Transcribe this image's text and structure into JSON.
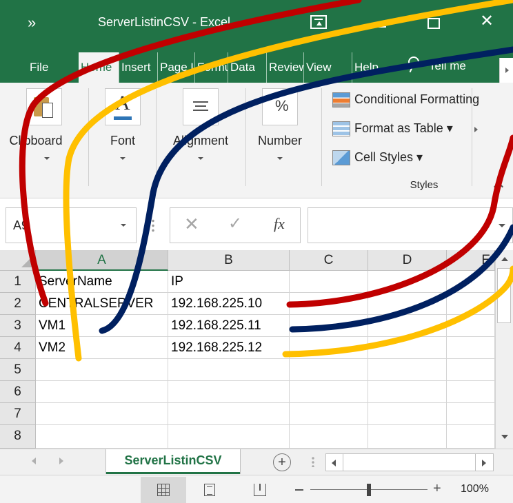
{
  "window": {
    "title": "ServerListinCSV  -  Excel",
    "qat_glyph": "»",
    "close_glyph": "✕"
  },
  "tabs": [
    {
      "label": "File"
    },
    {
      "label": "Home"
    },
    {
      "label": "Insert"
    },
    {
      "label": "Page Layout"
    },
    {
      "label": "Formulas"
    },
    {
      "label": "Data"
    },
    {
      "label": "Review"
    },
    {
      "label": "View"
    },
    {
      "label": "Help"
    }
  ],
  "tell_me": "Tell me",
  "ribbon": {
    "clipboard": "Clipboard",
    "font": "Font",
    "alignment": "Alignment",
    "number": "Number",
    "number_glyph": "%",
    "font_glyph": "A",
    "conditional_formatting": "Conditional Formatting",
    "format_as_table": "Format as Table ▾",
    "cell_styles": "Cell Styles ▾",
    "styles": "Styles"
  },
  "formula_bar": {
    "name_box": "A9",
    "cancel_glyph": "✕",
    "enter_glyph": "✓",
    "fx_glyph": "fx",
    "formula": ""
  },
  "columns": [
    "A",
    "B",
    "C",
    "D",
    "E"
  ],
  "rows": [
    "1",
    "2",
    "3",
    "4",
    "5",
    "6",
    "7",
    "8"
  ],
  "cells": {
    "A1": "ServerName",
    "B1": "IP",
    "A2": "CENTRALSERVER",
    "B2": "192.168.225.10",
    "A3": "VM1",
    "B3": "192.168.225.11",
    "A4": "VM2",
    "B4": "192.168.225.12"
  },
  "sheet_tab": "ServerListinCSV",
  "add_sheet_glyph": "+",
  "zoom": {
    "minus": "−",
    "plus": "+",
    "percent": "100%",
    "level": 0.5
  },
  "annotation_colors": {
    "red": "#c00000",
    "yellow": "#ffc000",
    "navy": "#002060"
  }
}
